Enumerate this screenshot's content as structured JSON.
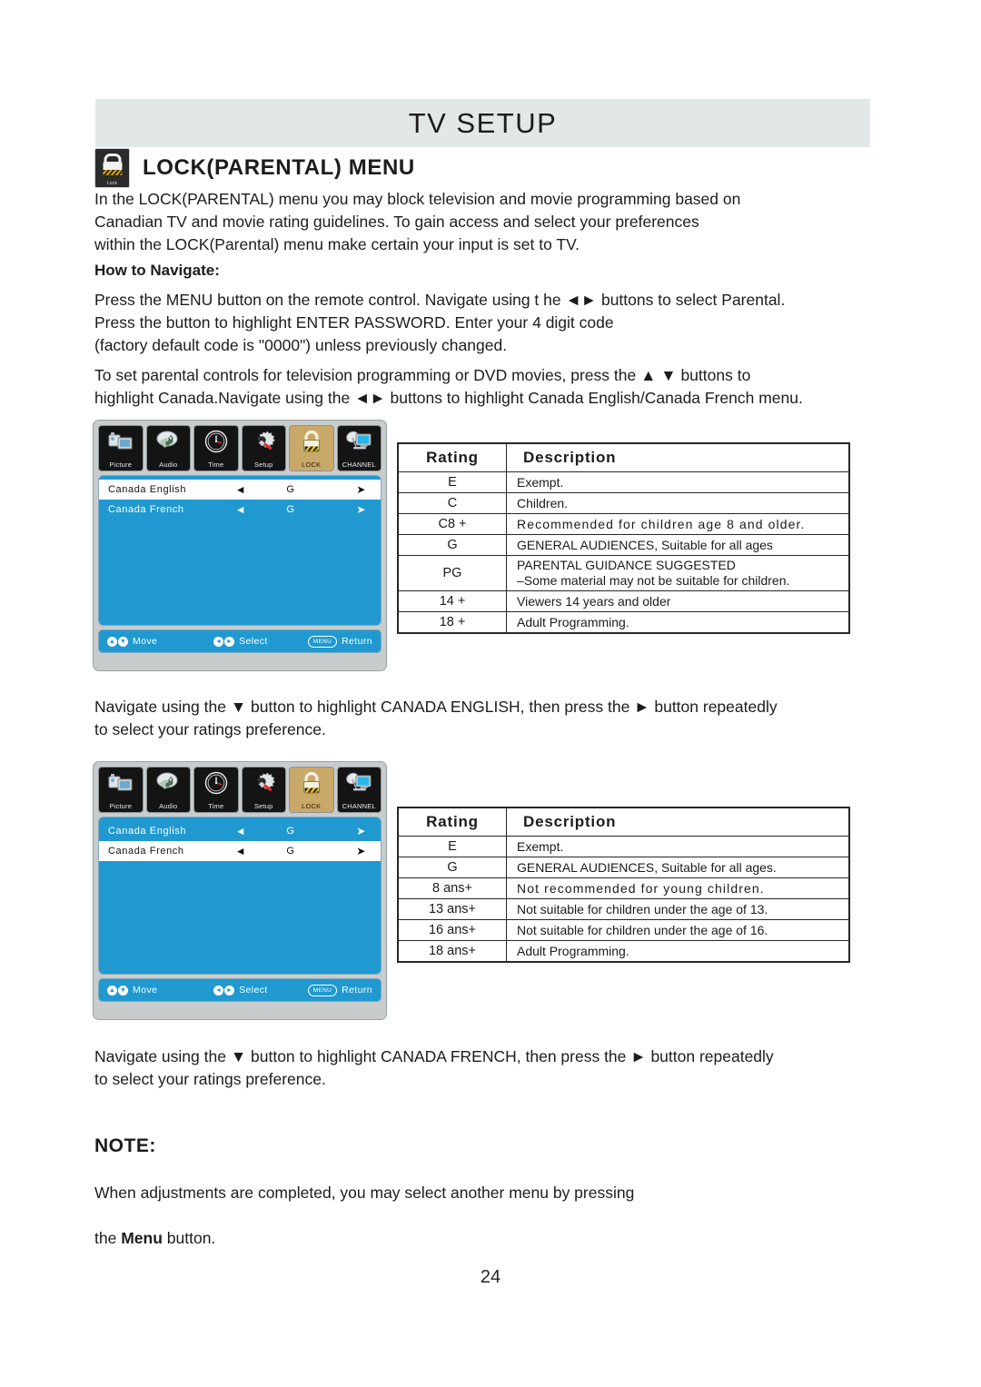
{
  "header": {
    "title": "TV SETUP"
  },
  "section": {
    "icon": "lock-icon",
    "icon_caption": "Lock",
    "title": "LOCK(PARENTAL) MENU"
  },
  "paragraphs": {
    "intro": "In the LOCK(PARENTAL) menu you may block television and movie programming based on\nCanadian TV and movie rating guidelines. To gain access and select your preferences\nwithin the LOCK(Parental) menu make certain your input is set to TV.",
    "how_to_navigate_heading": "How to Navigate:",
    "navigate_1": "Press the MENU button on the remote control. Navigate using t he ◄► buttons to select Parental.\nPress the button to highlight ENTER PASSWORD. Enter your 4 digit code\n(factory default code is \"0000\") unless previously changed.",
    "navigate_2": "To set parental controls for television programming or DVD movies, press the ▲ ▼ buttons to\nhighlight Canada.Navigate using the ◄► buttons to highlight Canada English/Canada French menu.",
    "canada_english": "Navigate using the ▼ button to highlight CANADA ENGLISH, then press the ► button repeatedly\nto select your ratings preference.",
    "canada_french": "Navigate using the ▼ button to highlight CANADA FRENCH, then press the ► button repeatedly\nto select your ratings preference."
  },
  "note": {
    "title": "NOTE:",
    "line1": "When adjustments are completed, you may select another menu by pressing",
    "line2_pre": "the ",
    "line2_bold": "Menu",
    "line2_post": " button."
  },
  "page_number": "24",
  "colors": {
    "header_band": "#e2e7e8",
    "osd_blue": "#2099d1",
    "osd_active_tab": "#c9a969",
    "osd_frame": "#c9cccd",
    "text": "#1c1c1c"
  },
  "osd": {
    "tabs": [
      {
        "label": "Picture",
        "icon": "camcorder-icon",
        "active": false
      },
      {
        "label": "Audio",
        "icon": "speaker-note-icon",
        "active": false
      },
      {
        "label": "Time",
        "icon": "clock-icon",
        "active": false
      },
      {
        "label": "Setup",
        "icon": "gear-wrench-icon",
        "active": false
      },
      {
        "label": "LOCK",
        "icon": "padlock-icon",
        "active": true
      },
      {
        "label": "CHANNEL",
        "icon": "satellite-tv-icon",
        "active": false
      }
    ],
    "left_arrow": "◄",
    "right_arrow": "➤",
    "hints": {
      "move": "Move",
      "select": "Select",
      "return": "Return",
      "menu_pill": "MENU",
      "move_icons": [
        "▲",
        "▼"
      ],
      "select_icons": [
        "◄",
        "►"
      ]
    },
    "screen_1": {
      "rows": [
        {
          "name": "Canada English",
          "value": "G",
          "selected": true
        },
        {
          "name": "Canada French",
          "value": "G",
          "selected": false
        }
      ]
    },
    "screen_2": {
      "rows": [
        {
          "name": "Canada English",
          "value": "G",
          "selected": false
        },
        {
          "name": "Canada French",
          "value": "G",
          "selected": true
        }
      ]
    }
  },
  "tables": {
    "canada_english": {
      "headers": [
        "Rating",
        "Description"
      ],
      "rows": [
        {
          "rating": "E",
          "desc": "Exempt."
        },
        {
          "rating": "C",
          "desc": "Children."
        },
        {
          "rating": "C8 +",
          "desc": "Recommended  for  children  age  8  and  older.",
          "spaced": true
        },
        {
          "rating": "G",
          "desc": "GENERAL AUDIENCES, Suitable for all ages"
        },
        {
          "rating": "PG",
          "desc_line1": "PARENTAL GUIDANCE SUGGESTED",
          "desc_line2": "–Some material may not be suitable for children."
        },
        {
          "rating": "14 +",
          "desc": "Viewers 14 years and older"
        },
        {
          "rating": "18 +",
          "desc": "Adult Programming."
        }
      ]
    },
    "canada_french": {
      "headers": [
        "Rating",
        "Description"
      ],
      "rows": [
        {
          "rating": "E",
          "desc": "Exempt."
        },
        {
          "rating": "G",
          "desc": "GENERAL AUDIENCES, Suitable for all ages."
        },
        {
          "rating": "8 ans+",
          "desc": "Not  recommended  for  young  children.",
          "spaced": true
        },
        {
          "rating": "13 ans+",
          "desc": "Not suitable for children under the age of 13."
        },
        {
          "rating": "16 ans+",
          "desc": "Not suitable for children under the age of 16."
        },
        {
          "rating": "18 ans+",
          "desc": "Adult Programming."
        }
      ]
    }
  }
}
